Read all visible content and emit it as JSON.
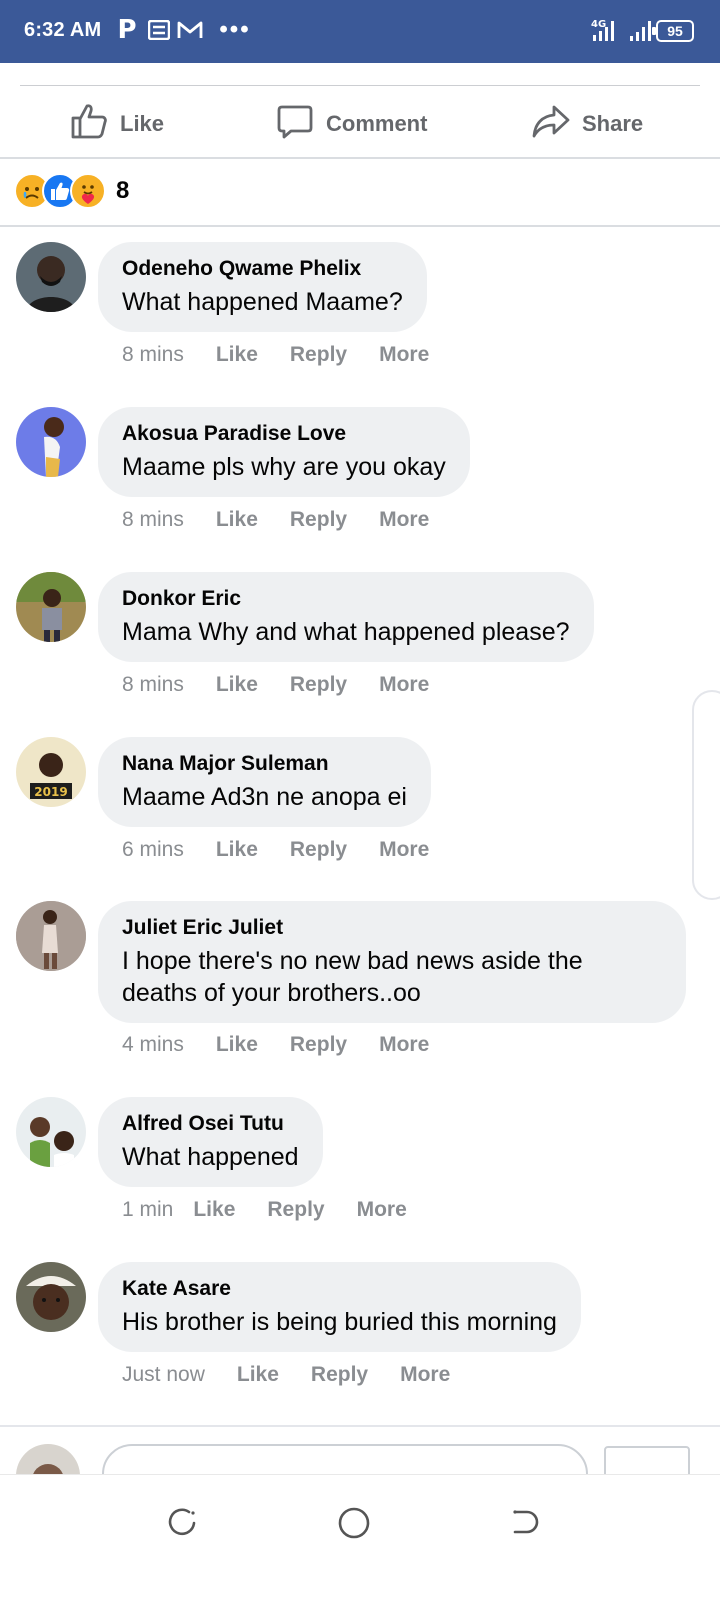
{
  "status_bar": {
    "time": "6:32 AM",
    "app_icon_letter": "P",
    "dots": "•••",
    "battery": "95",
    "network": "4G"
  },
  "actions": {
    "like": "Like",
    "comment": "Comment",
    "share": "Share"
  },
  "reactions": {
    "count": "8",
    "types": [
      "sad-icon",
      "like-icon",
      "care-icon"
    ]
  },
  "comments": [
    {
      "name": "Odeneho Qwame Phelix",
      "text": "What happened Maame?",
      "time": "8 mins",
      "like": "Like",
      "reply": "Reply",
      "more": "More"
    },
    {
      "name": "Akosua Paradise Love",
      "text": "Maame pls why are you okay",
      "time": "8 mins",
      "like": "Like",
      "reply": "Reply",
      "more": "More"
    },
    {
      "name": "Donkor Eric",
      "text": "Mama Why and what happened please?",
      "time": "8 mins",
      "like": "Like",
      "reply": "Reply",
      "more": "More"
    },
    {
      "name": "Nana Major Suleman",
      "text": "Maame Ad3n ne anopa ei",
      "time": "6 mins",
      "like": "Like",
      "reply": "Reply",
      "more": "More"
    },
    {
      "name": "Juliet Eric Juliet",
      "text": "I hope there's no new bad news aside the deaths of your brothers..oo",
      "time": "4 mins",
      "like": "Like",
      "reply": "Reply",
      "more": "More"
    },
    {
      "name": "Alfred Osei Tutu",
      "text": "What happened",
      "time": "1 min",
      "like": "Like",
      "reply": "Reply",
      "more": "More"
    },
    {
      "name": "Kate Asare",
      "text": "His brother is being buried this morning",
      "time": "Just now",
      "like": "Like",
      "reply": "Reply",
      "more": "More"
    }
  ],
  "composer": {
    "placeholder": ""
  },
  "colors": {
    "status_bar": "#3b5998",
    "bubble": "#eef0f2",
    "meta_text": "#8a8d91",
    "action_text": "#65676b"
  }
}
